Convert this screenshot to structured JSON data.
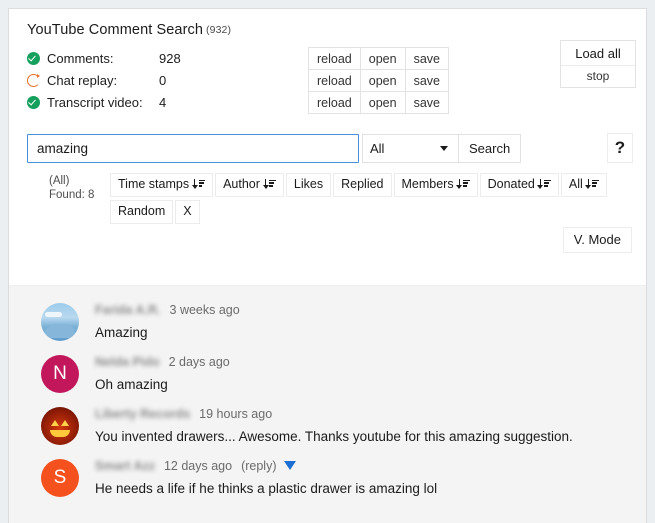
{
  "app": {
    "title": "YouTube Comment Search",
    "title_count": "(932)"
  },
  "status": {
    "rows": [
      {
        "icon": "check-circle-icon",
        "label": "Comments:",
        "value": "928"
      },
      {
        "icon": "refresh-circle-icon",
        "label": "Chat replay:",
        "value": "0"
      },
      {
        "icon": "check-circle-icon",
        "label": "Transcript video:",
        "value": "4"
      }
    ],
    "actions": [
      "reload",
      "open",
      "save"
    ],
    "load_all_label": "Load all",
    "stop_label": "stop"
  },
  "search": {
    "value": "amazing",
    "placeholder": "",
    "scope_selected": "All",
    "scope_options": [
      "All"
    ],
    "button_label": "Search",
    "help_label": "?"
  },
  "filters": {
    "found_scope": "(All)",
    "found_label": "Found: 8",
    "chips": [
      {
        "label": "Time stamps",
        "sort": true
      },
      {
        "label": "Author",
        "sort": true
      },
      {
        "label": "Likes",
        "sort": false
      },
      {
        "label": "Replied",
        "sort": false
      },
      {
        "label": "Members",
        "sort": true
      },
      {
        "label": "Donated",
        "sort": true
      },
      {
        "label": "All",
        "sort": true
      },
      {
        "label": "Random",
        "sort": false
      },
      {
        "label": "X",
        "sort": false
      }
    ],
    "vmode_label": "V. Mode"
  },
  "comments": [
    {
      "avatar_kind": "photo-sky",
      "avatar_letter": "",
      "avatar_color": "#9ccbea",
      "author": "Farida A.R.",
      "timestamp": "3 weeks ago",
      "reply_label": "",
      "text": "Amazing"
    },
    {
      "avatar_kind": "letter",
      "avatar_letter": "N",
      "avatar_color": "#c2185b",
      "author": "Nelda Pido",
      "timestamp": "2 days ago",
      "reply_label": "",
      "text": "Oh amazing"
    },
    {
      "avatar_kind": "photo-pumpkin",
      "avatar_letter": "",
      "avatar_color": "#8c1b06",
      "author": "Liberty Records",
      "timestamp": "19 hours ago",
      "reply_label": "",
      "text": "You invented drawers... Awesome. Thanks youtube for this amazing suggestion."
    },
    {
      "avatar_kind": "letter",
      "avatar_letter": "S",
      "avatar_color": "#f4511e",
      "author": "Smart Azz",
      "timestamp": "12 days ago",
      "reply_label": "(reply)",
      "text": "He needs a life if he thinks a plastic drawer is amazing lol"
    }
  ],
  "colors": {
    "accent_blue": "#4a90d9",
    "ok_green": "#16a05d",
    "busy_orange": "#e8702a",
    "reply_caret_blue": "#1d6fd4"
  }
}
